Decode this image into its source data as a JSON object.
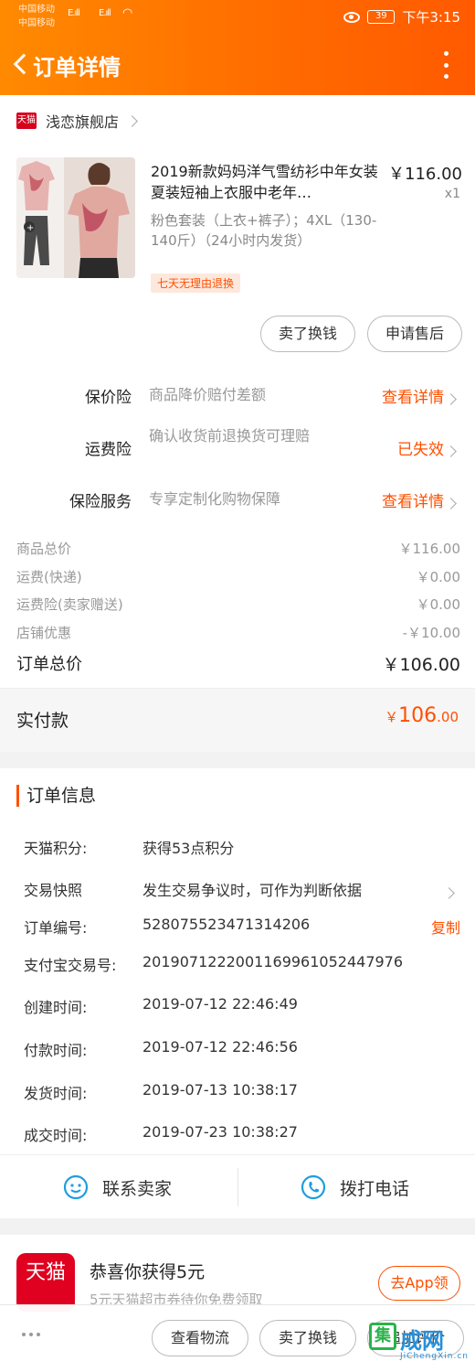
{
  "statusbar": {
    "carrier1": "中国移动",
    "carrier2": "中国移动",
    "sig1": "E.ıll",
    "sig2": "E.ıll",
    "battery": "39",
    "time": "下午3:15"
  },
  "nav": {
    "title": "订单详情"
  },
  "shop": {
    "badge": "天猫",
    "name": "浅恋旗舰店"
  },
  "product": {
    "title": "2019新款妈妈洋气雪纺衫中年女装夏装短袖上衣服中老年…",
    "price": "￥116.00",
    "qty": "x1",
    "sku": "粉色套装（上衣+裤子）；4XL（130-140斤）（24小时内发货）",
    "tag": "七天无理由退换"
  },
  "actions": {
    "sell": "卖了换钱",
    "after_sale": "申请售后"
  },
  "services": [
    {
      "label": "保价险",
      "desc": "商品降价赔付差额",
      "action": "查看详情"
    },
    {
      "label": "运费险",
      "desc": "确认收货前退换货可理赔",
      "action": "已失效"
    },
    {
      "label": "保险服务",
      "desc": "专享定制化购物保障",
      "action": "查看详情"
    }
  ],
  "fees": [
    {
      "label": "商品总价",
      "value": "￥116.00"
    },
    {
      "label": "运费(快递)",
      "value": "￥0.00"
    },
    {
      "label": "运费险(卖家赠送)",
      "value": "￥0.00"
    },
    {
      "label": "店铺优惠",
      "value": "-￥10.00"
    }
  ],
  "total": {
    "label": "订单总价",
    "value": "￥106.00"
  },
  "paid": {
    "label": "实付款",
    "currency": "￥",
    "int": "106",
    "dec": ".00"
  },
  "order_info": {
    "title": "订单信息",
    "copy": "复制",
    "rows": [
      {
        "k": "天猫积分:",
        "v": "获得53点积分"
      },
      {
        "k": "交易快照",
        "v": "发生交易争议时，可作为判断依据"
      },
      {
        "k": "订单编号:",
        "v": "528075523471314206"
      },
      {
        "k": "支付宝交易号:",
        "v": "2019071222001169961052447976"
      },
      {
        "k": "创建时间:",
        "v": "2019-07-12 22:46:49"
      },
      {
        "k": "付款时间:",
        "v": "2019-07-12 22:46:56"
      },
      {
        "k": "发货时间:",
        "v": "2019-07-13 10:38:17"
      },
      {
        "k": "成交时间:",
        "v": "2019-07-23 10:38:27"
      }
    ]
  },
  "contact": {
    "seller": "联系卖家",
    "phone": "拨打电话"
  },
  "promo": {
    "logo": "天猫",
    "title": "恭喜你获得5元",
    "sub": "5元天猫超市券待你免费领取",
    "button": "去App领"
  },
  "bottom": {
    "logistics": "查看物流",
    "sell": "卖了换钱",
    "review": "追加评价"
  },
  "watermark": {
    "mark": "集",
    "text": "成网",
    "sub": "JiChengXin.cn"
  },
  "colors": {
    "accent": "#ff5000",
    "header": "#ff7a00",
    "link_blue": "#1e9de0"
  }
}
